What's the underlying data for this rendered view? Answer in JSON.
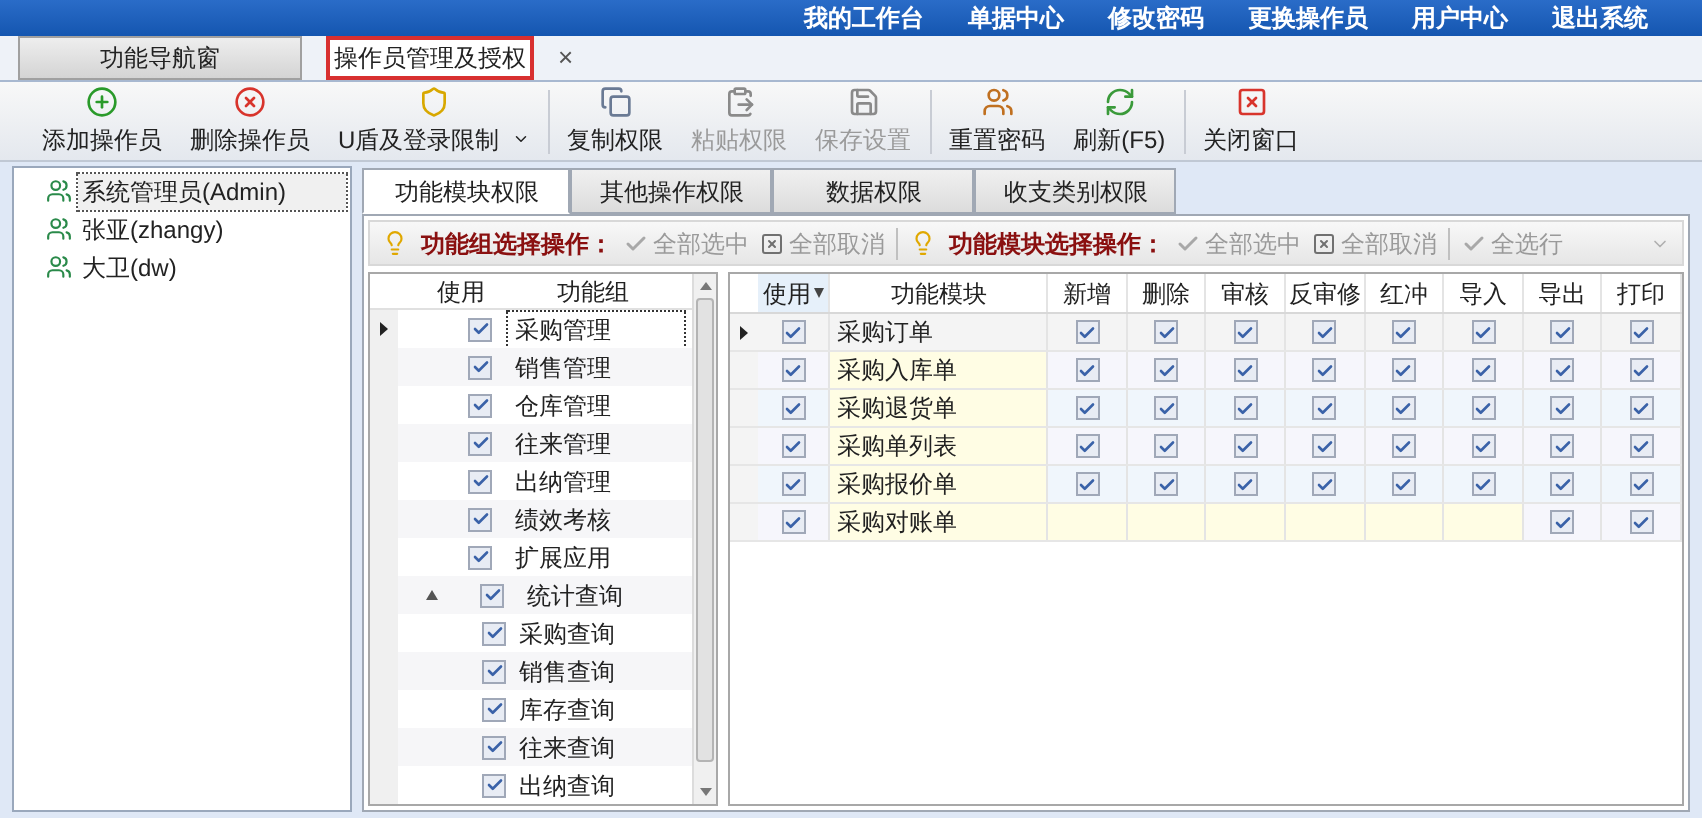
{
  "top_links": [
    "我的工作台",
    "单据中心",
    "修改密码",
    "更换操作员",
    "用户中心",
    "退出系统"
  ],
  "tabs": [
    {
      "label": "功能导航窗",
      "selected": false
    },
    {
      "label": "操作员管理及授权",
      "selected": true,
      "close": "×"
    }
  ],
  "toolbar": [
    {
      "label": "添加操作员",
      "kind": "add",
      "disabled": false,
      "dropdown": false
    },
    {
      "label": "删除操作员",
      "kind": "delete",
      "disabled": false,
      "dropdown": false
    },
    {
      "label": "U盾及登录限制",
      "kind": "shield",
      "disabled": false,
      "dropdown": true
    },
    {
      "label": "复制权限",
      "kind": "copy",
      "disabled": false,
      "dropdown": false
    },
    {
      "label": "粘贴权限",
      "kind": "paste",
      "disabled": true,
      "dropdown": false
    },
    {
      "label": "保存设置",
      "kind": "save",
      "disabled": true,
      "dropdown": false
    },
    {
      "label": "重置密码",
      "kind": "users",
      "disabled": false,
      "dropdown": false
    },
    {
      "label": "刷新(F5)",
      "kind": "refresh",
      "disabled": false,
      "dropdown": false
    },
    {
      "label": "关闭窗口",
      "kind": "close",
      "disabled": false,
      "dropdown": false
    }
  ],
  "operators": [
    {
      "name": "系统管理员(Admin)",
      "selected": true
    },
    {
      "name": "张亚(zhangy)",
      "selected": false
    },
    {
      "name": "大卫(dw)",
      "selected": false
    }
  ],
  "sub_tabs": [
    {
      "label": "功能模块权限",
      "selected": true
    },
    {
      "label": "其他操作权限",
      "selected": false
    },
    {
      "label": "数据权限",
      "selected": false
    },
    {
      "label": "收支类别权限",
      "selected": false
    }
  ],
  "action_groups": [
    {
      "title": "功能组选择操作：",
      "actions": [
        {
          "label": "全部选中",
          "kind": "check",
          "disabled": true
        },
        {
          "label": "全部取消",
          "kind": "uncheck",
          "disabled": true
        }
      ]
    },
    {
      "title": "功能模块选择操作：",
      "actions": [
        {
          "label": "全部选中",
          "kind": "check",
          "disabled": true
        },
        {
          "label": "全部取消",
          "kind": "uncheck",
          "disabled": true
        },
        {
          "label": "全选行",
          "kind": "check",
          "disabled": true
        }
      ]
    }
  ],
  "groups_grid": {
    "columns": [
      "使用",
      "功能组"
    ],
    "rows": [
      {
        "name": "采购管理",
        "checked": true,
        "current": true
      },
      {
        "name": "销售管理",
        "checked": true,
        "current": false
      },
      {
        "name": "仓库管理",
        "checked": true,
        "current": false
      },
      {
        "name": "往来管理",
        "checked": true,
        "current": false
      },
      {
        "name": "出纳管理",
        "checked": true,
        "current": false
      },
      {
        "name": "绩效考核",
        "checked": true,
        "current": false
      },
      {
        "name": "扩展应用",
        "checked": true,
        "current": false
      },
      {
        "name": "统计查询",
        "checked": true,
        "current": false,
        "expanded": true,
        "children": [
          {
            "name": "采购查询",
            "checked": true
          },
          {
            "name": "销售查询",
            "checked": true
          },
          {
            "name": "库存查询",
            "checked": true
          },
          {
            "name": "往来查询",
            "checked": true
          },
          {
            "name": "出纳查询",
            "checked": true
          }
        ]
      }
    ]
  },
  "modules_grid": {
    "columns": [
      "使用",
      "功能模块",
      "新增",
      "删除",
      "审核",
      "反审修",
      "红冲",
      "导入",
      "导出",
      "打印"
    ],
    "rows": [
      {
        "name": "采购订单",
        "use": true,
        "current": true,
        "perms": [
          {
            "kind": "checkbox",
            "checked": true
          },
          {
            "kind": "checkbox",
            "checked": true
          },
          {
            "kind": "checkbox",
            "checked": true
          },
          {
            "kind": "checkbox",
            "checked": true
          },
          {
            "kind": "checkbox",
            "checked": true
          },
          {
            "kind": "checkbox",
            "checked": true
          },
          {
            "kind": "checkbox",
            "checked": true
          },
          {
            "kind": "checkbox",
            "checked": true
          }
        ]
      },
      {
        "name": "采购入库单",
        "use": true,
        "current": false,
        "perms": [
          {
            "kind": "checkbox",
            "checked": true
          },
          {
            "kind": "checkbox",
            "checked": true
          },
          {
            "kind": "checkbox",
            "checked": true
          },
          {
            "kind": "checkbox",
            "checked": true
          },
          {
            "kind": "checkbox",
            "checked": true
          },
          {
            "kind": "checkbox",
            "checked": true
          },
          {
            "kind": "checkbox",
            "checked": true
          },
          {
            "kind": "checkbox",
            "checked": true
          }
        ]
      },
      {
        "name": "采购退货单",
        "use": true,
        "current": false,
        "perms": [
          {
            "kind": "checkbox",
            "checked": true
          },
          {
            "kind": "checkbox",
            "checked": true
          },
          {
            "kind": "checkbox",
            "checked": true
          },
          {
            "kind": "checkbox",
            "checked": true
          },
          {
            "kind": "checkbox",
            "checked": true
          },
          {
            "kind": "checkbox",
            "checked": true
          },
          {
            "kind": "checkbox",
            "checked": true
          },
          {
            "kind": "checkbox",
            "checked": true
          }
        ]
      },
      {
        "name": "采购单列表",
        "use": true,
        "current": false,
        "perms": [
          {
            "kind": "checkbox",
            "checked": true
          },
          {
            "kind": "checkbox",
            "checked": true
          },
          {
            "kind": "checkbox",
            "checked": true
          },
          {
            "kind": "checkbox",
            "checked": true
          },
          {
            "kind": "checkbox",
            "checked": true
          },
          {
            "kind": "checkbox",
            "checked": true
          },
          {
            "kind": "checkbox",
            "checked": true
          },
          {
            "kind": "checkbox",
            "checked": true
          }
        ]
      },
      {
        "name": "采购报价单",
        "use": true,
        "current": false,
        "perms": [
          {
            "kind": "checkbox",
            "checked": true
          },
          {
            "kind": "checkbox",
            "checked": true
          },
          {
            "kind": "checkbox",
            "checked": true
          },
          {
            "kind": "checkbox",
            "checked": true
          },
          {
            "kind": "checkbox",
            "checked": true
          },
          {
            "kind": "checkbox",
            "checked": true
          },
          {
            "kind": "checkbox",
            "checked": true
          },
          {
            "kind": "checkbox",
            "checked": true
          }
        ]
      },
      {
        "name": "采购对账单",
        "use": true,
        "current": false,
        "perms": [
          {
            "kind": "empty"
          },
          {
            "kind": "empty"
          },
          {
            "kind": "empty"
          },
          {
            "kind": "empty"
          },
          {
            "kind": "empty"
          },
          {
            "kind": "empty"
          },
          {
            "kind": "checkbox",
            "checked": true
          },
          {
            "kind": "checkbox",
            "checked": true
          }
        ]
      }
    ]
  }
}
